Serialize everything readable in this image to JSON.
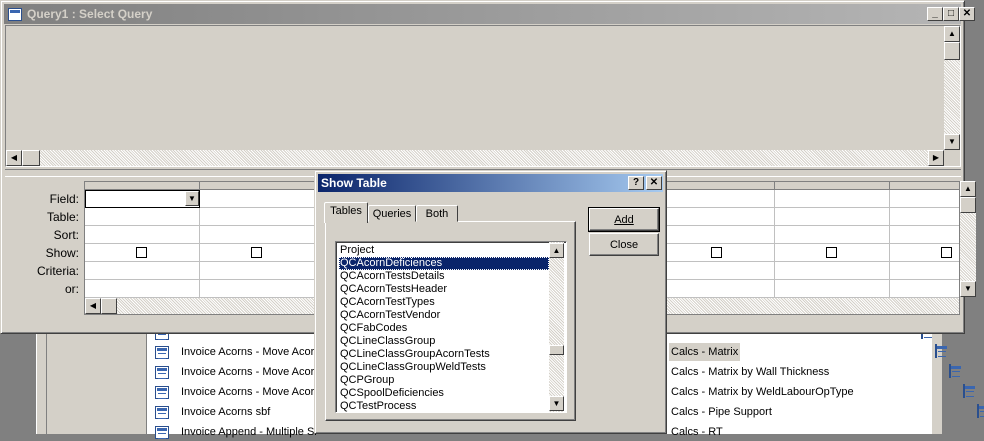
{
  "query_window": {
    "title": "Query1 : Select Query",
    "caption_buttons": {
      "minimize": "_",
      "maximize": "□",
      "close": "✕"
    }
  },
  "grid": {
    "row_labels": [
      "Field:",
      "Table:",
      "Sort:",
      "Show:",
      "Criteria:",
      "or:"
    ]
  },
  "dialog": {
    "title": "Show Table",
    "help_label": "?",
    "close_label": "✕",
    "tabs": [
      "Tables",
      "Queries",
      "Both"
    ],
    "active_tab": "Tables",
    "buttons": {
      "add": "Add",
      "close": "Close"
    },
    "items": [
      "Project",
      "QCAcornDeficiences",
      "QCAcornTestsDetails",
      "QCAcornTestsHeader",
      "QCAcornTestTypes",
      "QCAcornTestVendor",
      "QCFabCodes",
      "QCLineClassGroup",
      "QCLineClassGroupAcornTests",
      "QCLineClassGroupWeldTests",
      "QCPGroup",
      "QCSpoolDeficiencies",
      "QCTestProcess"
    ],
    "selected_item": "QCAcornDeficiences"
  },
  "background_list": {
    "left_items": [
      "Invoice Acorns - Move Acorn",
      "Invoice Acorns - Move Acorn",
      "Invoice Acorns - Move Acorn",
      "Invoice Acorns sbf",
      "Invoice Append - Multiple Sl"
    ],
    "right_items": [
      "Calcs - Matrix",
      "Calcs - Matrix by Wall Thickness",
      "Calcs - Matrix by WeldLabourOpType",
      "Calcs - Pipe Support",
      "Calcs - RT"
    ]
  }
}
